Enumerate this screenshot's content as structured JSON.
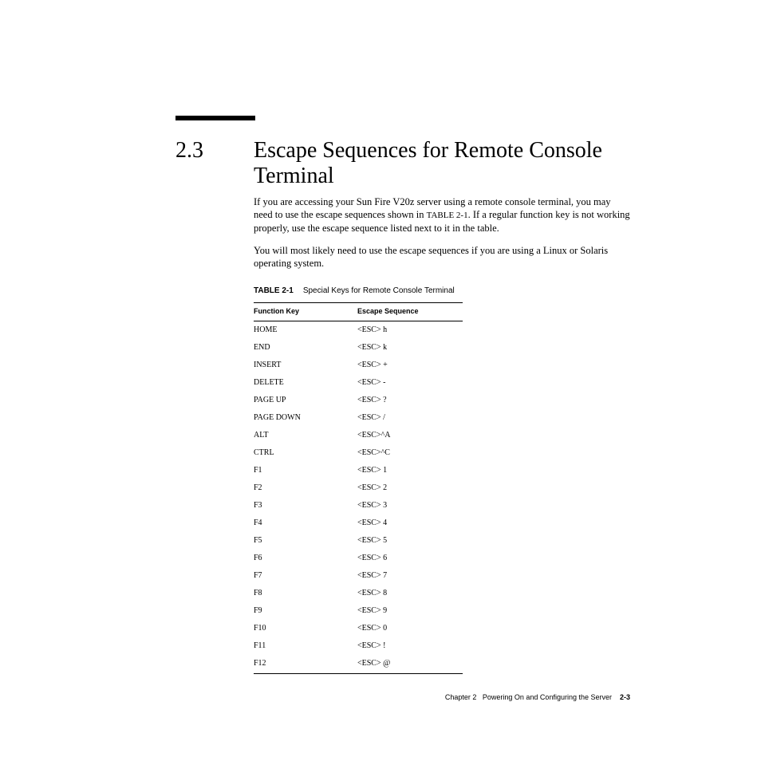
{
  "section_number": "2.3",
  "section_title": "Escape Sequences for Remote Console Terminal",
  "paragraph1_a": "If you are accessing your Sun Fire V20z server using a remote console terminal, you may need to use the escape sequences shown in ",
  "table_ref_inline": "TABLE 2-1",
  "paragraph1_b": ". If a regular function key is not working properly, use the escape sequence listed next to it in the table.",
  "paragraph2": "You will most likely need to use the escape sequences if you are using a Linux or Solaris operating system.",
  "table_label": "TABLE 2-1",
  "table_caption": "Special Keys for Remote Console Terminal",
  "table_headers": {
    "col1": "Function Key",
    "col2": "Escape Sequence"
  },
  "rows": [
    {
      "key": "HOME",
      "seq": "<ESC> h"
    },
    {
      "key": "END",
      "seq": "<ESC> k"
    },
    {
      "key": "INSERT",
      "seq": "<ESC> +"
    },
    {
      "key": "DELETE",
      "seq": "<ESC> -"
    },
    {
      "key": "PAGE UP",
      "seq": "<ESC> ?"
    },
    {
      "key": "PAGE DOWN",
      "seq": "<ESC> /"
    },
    {
      "key": "ALT",
      "seq": "<ESC>^A"
    },
    {
      "key": "CTRL",
      "seq": "<ESC>^C"
    },
    {
      "key": "F1",
      "seq": "<ESC> 1"
    },
    {
      "key": "F2",
      "seq": "<ESC> 2"
    },
    {
      "key": "F3",
      "seq": "<ESC> 3"
    },
    {
      "key": "F4",
      "seq": "<ESC> 4"
    },
    {
      "key": "F5",
      "seq": "<ESC> 5"
    },
    {
      "key": "F6",
      "seq": "<ESC> 6"
    },
    {
      "key": "F7",
      "seq": "<ESC> 7"
    },
    {
      "key": "F8",
      "seq": "<ESC> 8"
    },
    {
      "key": "F9",
      "seq": "<ESC> 9"
    },
    {
      "key": "F10",
      "seq": "<ESC> 0"
    },
    {
      "key": "F11",
      "seq": "<ESC> !"
    },
    {
      "key": "F12",
      "seq": "<ESC> @"
    }
  ],
  "footer_chapter": "Chapter 2",
  "footer_title": "Powering On and Configuring the Server",
  "footer_page": "2-3"
}
